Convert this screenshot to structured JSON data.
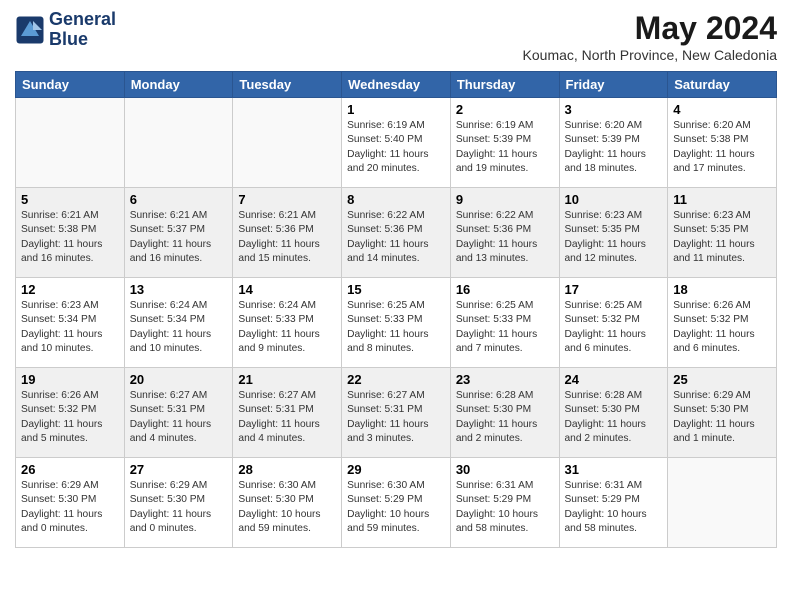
{
  "header": {
    "logo_line1": "General",
    "logo_line2": "Blue",
    "month_year": "May 2024",
    "location": "Koumac, North Province, New Caledonia"
  },
  "days_of_week": [
    "Sunday",
    "Monday",
    "Tuesday",
    "Wednesday",
    "Thursday",
    "Friday",
    "Saturday"
  ],
  "weeks": [
    [
      {
        "num": "",
        "lines": [],
        "empty": true
      },
      {
        "num": "",
        "lines": [],
        "empty": true
      },
      {
        "num": "",
        "lines": [],
        "empty": true
      },
      {
        "num": "1",
        "lines": [
          "Sunrise: 6:19 AM",
          "Sunset: 5:40 PM",
          "Daylight: 11 hours",
          "and 20 minutes."
        ],
        "empty": false
      },
      {
        "num": "2",
        "lines": [
          "Sunrise: 6:19 AM",
          "Sunset: 5:39 PM",
          "Daylight: 11 hours",
          "and 19 minutes."
        ],
        "empty": false
      },
      {
        "num": "3",
        "lines": [
          "Sunrise: 6:20 AM",
          "Sunset: 5:39 PM",
          "Daylight: 11 hours",
          "and 18 minutes."
        ],
        "empty": false
      },
      {
        "num": "4",
        "lines": [
          "Sunrise: 6:20 AM",
          "Sunset: 5:38 PM",
          "Daylight: 11 hours",
          "and 17 minutes."
        ],
        "empty": false
      }
    ],
    [
      {
        "num": "5",
        "lines": [
          "Sunrise: 6:21 AM",
          "Sunset: 5:38 PM",
          "Daylight: 11 hours",
          "and 16 minutes."
        ],
        "empty": false
      },
      {
        "num": "6",
        "lines": [
          "Sunrise: 6:21 AM",
          "Sunset: 5:37 PM",
          "Daylight: 11 hours",
          "and 16 minutes."
        ],
        "empty": false
      },
      {
        "num": "7",
        "lines": [
          "Sunrise: 6:21 AM",
          "Sunset: 5:36 PM",
          "Daylight: 11 hours",
          "and 15 minutes."
        ],
        "empty": false
      },
      {
        "num": "8",
        "lines": [
          "Sunrise: 6:22 AM",
          "Sunset: 5:36 PM",
          "Daylight: 11 hours",
          "and 14 minutes."
        ],
        "empty": false
      },
      {
        "num": "9",
        "lines": [
          "Sunrise: 6:22 AM",
          "Sunset: 5:36 PM",
          "Daylight: 11 hours",
          "and 13 minutes."
        ],
        "empty": false
      },
      {
        "num": "10",
        "lines": [
          "Sunrise: 6:23 AM",
          "Sunset: 5:35 PM",
          "Daylight: 11 hours",
          "and 12 minutes."
        ],
        "empty": false
      },
      {
        "num": "11",
        "lines": [
          "Sunrise: 6:23 AM",
          "Sunset: 5:35 PM",
          "Daylight: 11 hours",
          "and 11 minutes."
        ],
        "empty": false
      }
    ],
    [
      {
        "num": "12",
        "lines": [
          "Sunrise: 6:23 AM",
          "Sunset: 5:34 PM",
          "Daylight: 11 hours",
          "and 10 minutes."
        ],
        "empty": false
      },
      {
        "num": "13",
        "lines": [
          "Sunrise: 6:24 AM",
          "Sunset: 5:34 PM",
          "Daylight: 11 hours",
          "and 10 minutes."
        ],
        "empty": false
      },
      {
        "num": "14",
        "lines": [
          "Sunrise: 6:24 AM",
          "Sunset: 5:33 PM",
          "Daylight: 11 hours",
          "and 9 minutes."
        ],
        "empty": false
      },
      {
        "num": "15",
        "lines": [
          "Sunrise: 6:25 AM",
          "Sunset: 5:33 PM",
          "Daylight: 11 hours",
          "and 8 minutes."
        ],
        "empty": false
      },
      {
        "num": "16",
        "lines": [
          "Sunrise: 6:25 AM",
          "Sunset: 5:33 PM",
          "Daylight: 11 hours",
          "and 7 minutes."
        ],
        "empty": false
      },
      {
        "num": "17",
        "lines": [
          "Sunrise: 6:25 AM",
          "Sunset: 5:32 PM",
          "Daylight: 11 hours",
          "and 6 minutes."
        ],
        "empty": false
      },
      {
        "num": "18",
        "lines": [
          "Sunrise: 6:26 AM",
          "Sunset: 5:32 PM",
          "Daylight: 11 hours",
          "and 6 minutes."
        ],
        "empty": false
      }
    ],
    [
      {
        "num": "19",
        "lines": [
          "Sunrise: 6:26 AM",
          "Sunset: 5:32 PM",
          "Daylight: 11 hours",
          "and 5 minutes."
        ],
        "empty": false
      },
      {
        "num": "20",
        "lines": [
          "Sunrise: 6:27 AM",
          "Sunset: 5:31 PM",
          "Daylight: 11 hours",
          "and 4 minutes."
        ],
        "empty": false
      },
      {
        "num": "21",
        "lines": [
          "Sunrise: 6:27 AM",
          "Sunset: 5:31 PM",
          "Daylight: 11 hours",
          "and 4 minutes."
        ],
        "empty": false
      },
      {
        "num": "22",
        "lines": [
          "Sunrise: 6:27 AM",
          "Sunset: 5:31 PM",
          "Daylight: 11 hours",
          "and 3 minutes."
        ],
        "empty": false
      },
      {
        "num": "23",
        "lines": [
          "Sunrise: 6:28 AM",
          "Sunset: 5:30 PM",
          "Daylight: 11 hours",
          "and 2 minutes."
        ],
        "empty": false
      },
      {
        "num": "24",
        "lines": [
          "Sunrise: 6:28 AM",
          "Sunset: 5:30 PM",
          "Daylight: 11 hours",
          "and 2 minutes."
        ],
        "empty": false
      },
      {
        "num": "25",
        "lines": [
          "Sunrise: 6:29 AM",
          "Sunset: 5:30 PM",
          "Daylight: 11 hours",
          "and 1 minute."
        ],
        "empty": false
      }
    ],
    [
      {
        "num": "26",
        "lines": [
          "Sunrise: 6:29 AM",
          "Sunset: 5:30 PM",
          "Daylight: 11 hours",
          "and 0 minutes."
        ],
        "empty": false
      },
      {
        "num": "27",
        "lines": [
          "Sunrise: 6:29 AM",
          "Sunset: 5:30 PM",
          "Daylight: 11 hours",
          "and 0 minutes."
        ],
        "empty": false
      },
      {
        "num": "28",
        "lines": [
          "Sunrise: 6:30 AM",
          "Sunset: 5:30 PM",
          "Daylight: 10 hours",
          "and 59 minutes."
        ],
        "empty": false
      },
      {
        "num": "29",
        "lines": [
          "Sunrise: 6:30 AM",
          "Sunset: 5:29 PM",
          "Daylight: 10 hours",
          "and 59 minutes."
        ],
        "empty": false
      },
      {
        "num": "30",
        "lines": [
          "Sunrise: 6:31 AM",
          "Sunset: 5:29 PM",
          "Daylight: 10 hours",
          "and 58 minutes."
        ],
        "empty": false
      },
      {
        "num": "31",
        "lines": [
          "Sunrise: 6:31 AM",
          "Sunset: 5:29 PM",
          "Daylight: 10 hours",
          "and 58 minutes."
        ],
        "empty": false
      },
      {
        "num": "",
        "lines": [],
        "empty": true
      }
    ]
  ]
}
